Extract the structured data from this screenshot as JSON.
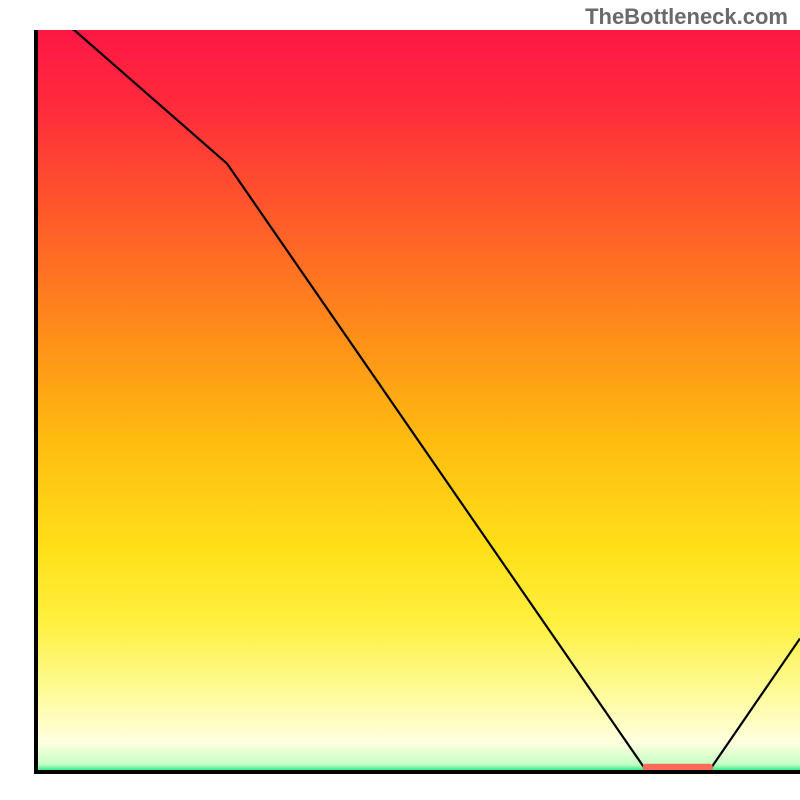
{
  "watermark": "TheBottleneck.com",
  "chart_data": {
    "type": "line",
    "title": "",
    "xlabel": "",
    "ylabel": "",
    "x": [
      0.0,
      0.05,
      0.25,
      0.8,
      0.88,
      1.0
    ],
    "values": [
      1.02,
      1.0,
      0.82,
      0.0,
      0.0,
      0.18
    ],
    "xlim": [
      0,
      1
    ],
    "ylim": [
      0,
      1
    ],
    "marker": {
      "x": 0.84,
      "y": 0.005
    },
    "gradient_stops": [
      {
        "offset": 0.0,
        "color": "#ff1744"
      },
      {
        "offset": 0.1,
        "color": "#ff2a3c"
      },
      {
        "offset": 0.25,
        "color": "#ff5a2a"
      },
      {
        "offset": 0.4,
        "color": "#ff8a1a"
      },
      {
        "offset": 0.55,
        "color": "#ffbb10"
      },
      {
        "offset": 0.7,
        "color": "#ffe018"
      },
      {
        "offset": 0.8,
        "color": "#fff040"
      },
      {
        "offset": 0.9,
        "color": "#fffca0"
      },
      {
        "offset": 0.96,
        "color": "#ffffe0"
      },
      {
        "offset": 0.99,
        "color": "#c4ffc4"
      },
      {
        "offset": 1.0,
        "color": "#00e676"
      }
    ],
    "axis_color": "#000000",
    "line_color": "#000000",
    "marker_color": "#ff6a5a"
  }
}
